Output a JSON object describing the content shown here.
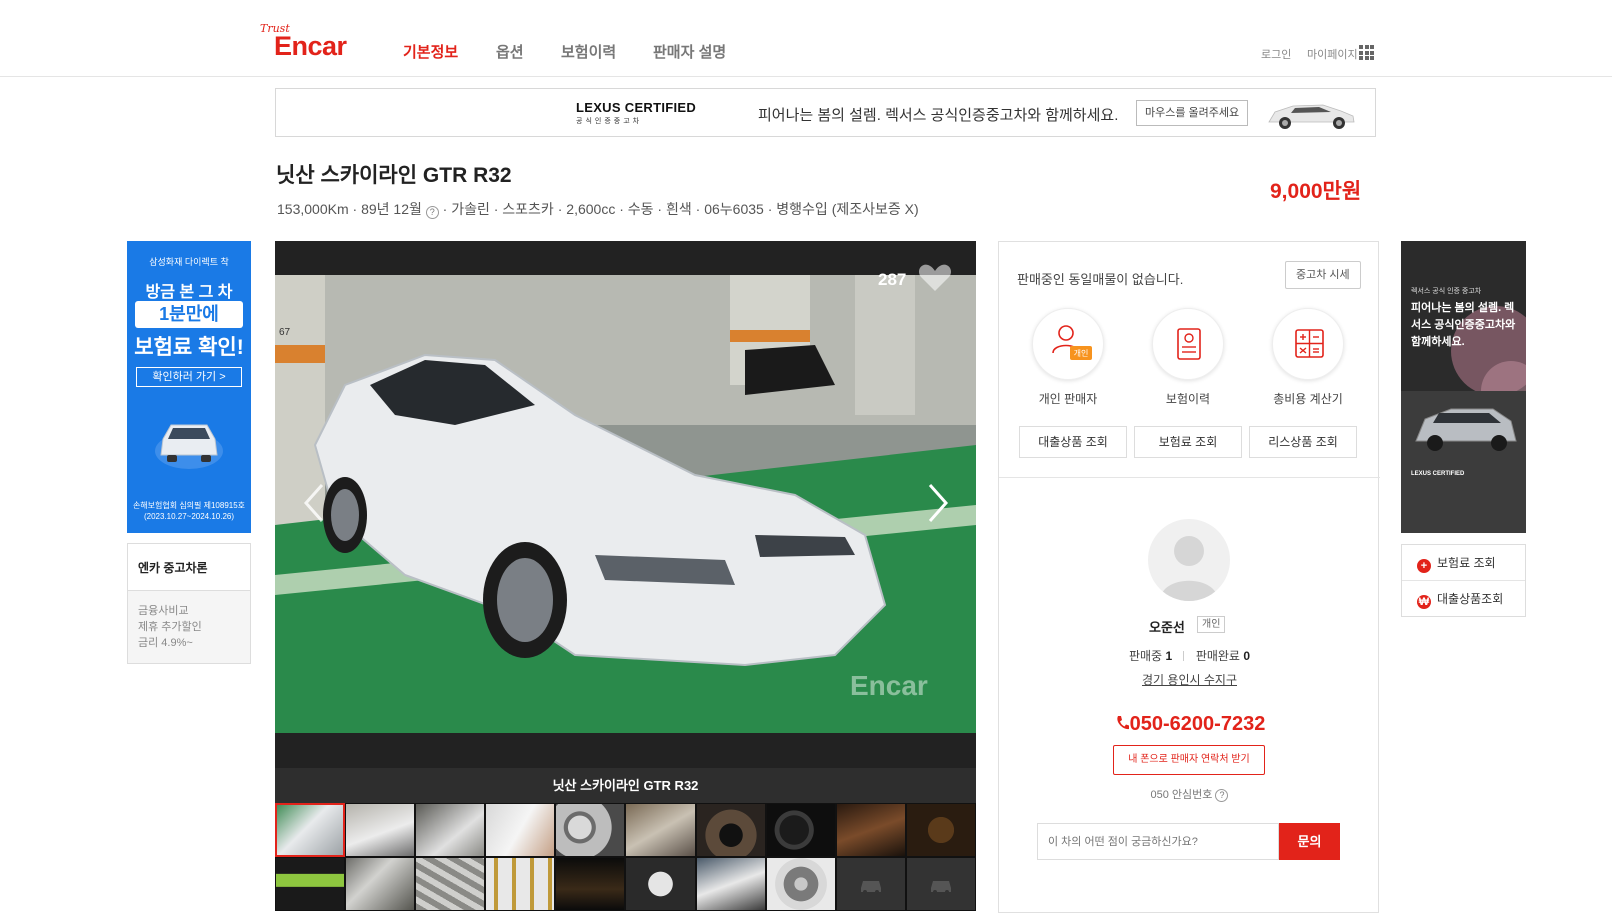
{
  "header": {
    "logo_trust": "Trust",
    "logo_text": "Encar",
    "tabs": [
      {
        "label": "기본정보"
      },
      {
        "label": "옵션"
      },
      {
        "label": "보험이력"
      },
      {
        "label": "판매자 설명"
      }
    ],
    "login": "로그인",
    "mypage": "마이페이지"
  },
  "banner": {
    "brand": "LEXUS CERTIFIED",
    "brand_sub": "공식인증중고차",
    "message": "피어나는 봄의 설렘. 렉서스 공식인증중고차와 함께하세요.",
    "hover_label": "마우스를 올려주세요"
  },
  "car": {
    "title": "닛산 스카이라인 GTR R32",
    "mileage": "153,000Km",
    "year": "89년 12월",
    "fuel": "가솔린",
    "body": "스포츠카",
    "displacement": "2,600cc",
    "transmission": "수동",
    "color": "흰색",
    "plate": "06누6035",
    "import_type": "병행수입 (제조사보증 X)",
    "price": "9,000만원"
  },
  "ad_left": {
    "company": "삼성화재 다이렉트 착",
    "line1": "방금 본 그 차",
    "line2": "1분만에",
    "line3": "보험료 확인!",
    "cta": "확인하러 가기 >",
    "fine_print1": "손해보험협회 심의필 제108915호",
    "fine_print2": "(2023.10.27~2024.10.26)"
  },
  "finance": {
    "title": "엔카 중고차론",
    "line1": "금융사비교",
    "line2": "제휴 추가할인",
    "line3": "금리 4.9%~"
  },
  "gallery": {
    "views": "287",
    "caption": "닛산 스카이라인 GTR R32",
    "watermark": "Encar"
  },
  "panel": {
    "same_listing": "판매중인 동일매물이 없습니다.",
    "market_price_button": "중고차 시세",
    "icons": [
      {
        "label": "개인 판매자",
        "badge": "개인"
      },
      {
        "label": "보험이력"
      },
      {
        "label": "총비용 계산기"
      }
    ],
    "buttons": [
      "대출상품 조회",
      "보험료 조회",
      "리스상품 조회"
    ],
    "seller_name": "오준선",
    "seller_type": "개인",
    "selling_label": "판매중",
    "selling_count": "1",
    "sold_label": "판매완료",
    "sold_count": "0",
    "location": "경기 용인시 수지구",
    "phone": "050-6200-7232",
    "get_contact": "내 폰으로 판매자 연락처 받기",
    "safe_number": "050 안심번호",
    "ask_placeholder": "이 차의 어떤 점이 궁금하신가요?",
    "ask_button": "문의"
  },
  "ad_right": {
    "small": "렉서스 공식 인증 중고차",
    "headline": "피어나는 봄의 설렘. 렉서스 공식인증중고차와 함께하세요.",
    "logo": "LEXUS CERTIFIED"
  },
  "quick_links": [
    {
      "label": "보험료 조회",
      "icon": "plus-icon"
    },
    {
      "label": "대출상품조회",
      "icon": "won-icon"
    }
  ],
  "colors": {
    "accent": "#e2231a",
    "ad_blue": "#1a7ae6"
  }
}
